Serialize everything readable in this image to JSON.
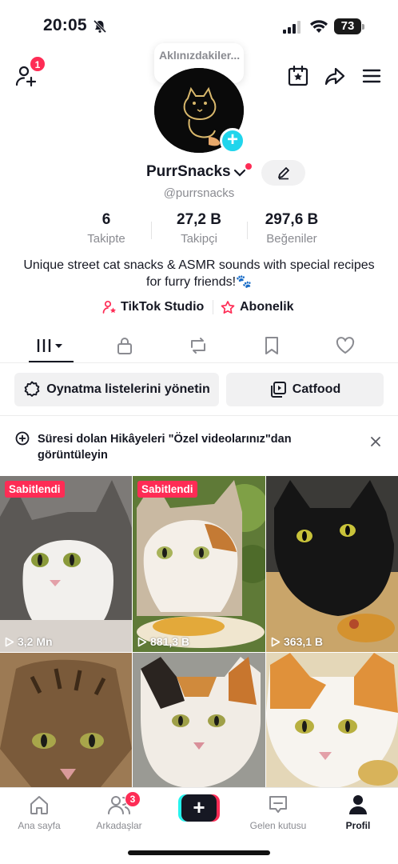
{
  "status_bar": {
    "time": "20:05",
    "battery": "73"
  },
  "top_nav": {
    "add_friend_badge": "1",
    "note_bubble": "Aklınızdakiler..."
  },
  "profile": {
    "username": "PurrSnacks",
    "handle": "@purrsnacks",
    "stats": [
      {
        "value": "6",
        "label": "Takipte"
      },
      {
        "value": "27,2 B",
        "label": "Takipçi"
      },
      {
        "value": "297,6 B",
        "label": "Beğeniler"
      }
    ],
    "bio": "Unique street cat snacks & ASMR sounds with special recipes for furry friends!🐾",
    "links": {
      "studio": "TikTok Studio",
      "subscription": "Abonelik"
    }
  },
  "playlists": {
    "manage_label": "Oynatma listelerini yönetin",
    "catfood_label": "Catfood"
  },
  "story_banner": {
    "text": "Süresi dolan Hikâyeleri \"Özel videolarınız\"dan görüntüleyin"
  },
  "videos": [
    {
      "pinned": "Sabitlendi",
      "views": "3,2 Mn"
    },
    {
      "pinned": "Sabitlendi",
      "views": "881,3 B"
    },
    {
      "pinned": "",
      "views": "363,1 B"
    },
    {
      "pinned": "",
      "views": ""
    },
    {
      "pinned": "",
      "views": ""
    },
    {
      "pinned": "",
      "views": ""
    }
  ],
  "bottom_nav": {
    "items": [
      {
        "label": "Ana sayfa"
      },
      {
        "label": "Arkadaşlar",
        "badge": "3"
      },
      {
        "label": ""
      },
      {
        "label": "Gelen kutusu"
      },
      {
        "label": "Profil"
      }
    ]
  },
  "colors": {
    "accent": "#fe2c55",
    "cyan": "#20d5ec",
    "text": "#161823",
    "muted": "#8a8b91"
  }
}
